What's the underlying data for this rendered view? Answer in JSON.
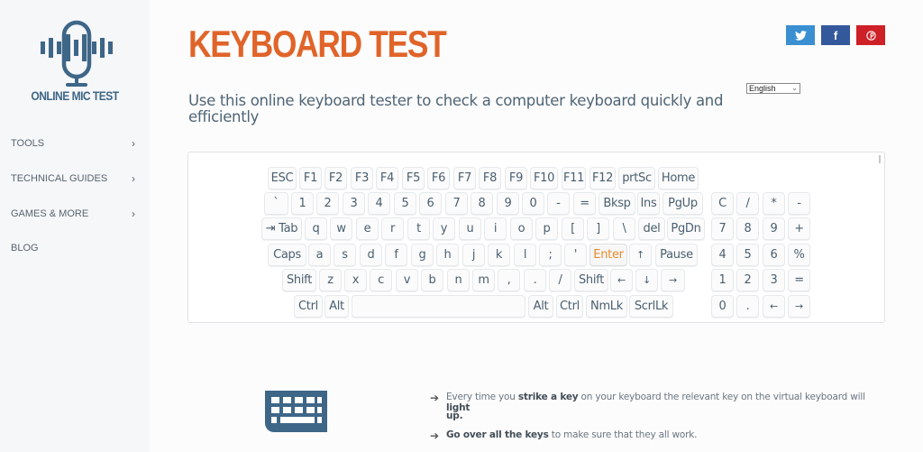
{
  "sidebar": {
    "logo_text": "ONLINE MIC TEST",
    "items": [
      {
        "label": "TOOLS",
        "chevron": "›"
      },
      {
        "label": "TECHNICAL GUIDES",
        "chevron": "›"
      },
      {
        "label": "GAMES & MORE",
        "chevron": "›"
      },
      {
        "label": "BLOG",
        "chevron": ""
      }
    ]
  },
  "header": {
    "title": "KEYBOARD TEST",
    "subtitle": "Use this online keyboard tester to check a computer keyboard quickly and efficiently",
    "social": [
      {
        "name": "twitter",
        "icon": "twitter-icon",
        "color": "#3a8fd1"
      },
      {
        "name": "facebook",
        "icon": "facebook-icon",
        "color": "#34589c"
      },
      {
        "name": "pinterest",
        "icon": "pinterest-icon",
        "color": "#cd2027"
      }
    ],
    "language": {
      "selected": "English"
    }
  },
  "keyboard": {
    "active_key": "Enter",
    "rows": [
      [
        "ESC",
        "F1",
        "F2",
        "F3",
        "F4",
        "F5",
        "F6",
        "F7",
        "F8",
        "F9",
        "F10",
        "F11",
        "F12",
        "prtSc",
        "Home"
      ],
      [
        "`",
        "1",
        "2",
        "3",
        "4",
        "5",
        "6",
        "7",
        "8",
        "9",
        "0",
        "-",
        "=",
        "Bksp",
        "Ins",
        "PgUp"
      ],
      [
        "⇥ Tab",
        "q",
        "w",
        "e",
        "r",
        "t",
        "y",
        "u",
        "i",
        "o",
        "p",
        "[",
        "]",
        "\\",
        "del",
        "PgDn"
      ],
      [
        "Caps",
        "a",
        "s",
        "d",
        "f",
        "g",
        "h",
        "j",
        "k",
        "l",
        ";",
        "'",
        "Enter",
        "↑",
        "Pause"
      ],
      [
        "Shift",
        "z",
        "x",
        "c",
        "v",
        "b",
        "n",
        "m",
        ",",
        ".",
        "/",
        "Shift",
        "←",
        "↓",
        "→"
      ],
      [
        "Ctrl",
        "Alt",
        "",
        "Alt",
        "Ctrl",
        "NmLk",
        "ScrlLk"
      ]
    ],
    "numpad": [
      [
        "C",
        "/",
        "*",
        "-"
      ],
      [
        "7",
        "8",
        "9",
        "+"
      ],
      [
        "4",
        "5",
        "6",
        "%"
      ],
      [
        "1",
        "2",
        "3",
        "="
      ],
      [
        "0",
        ".",
        "←",
        "→"
      ]
    ]
  },
  "tips": [
    {
      "parts": [
        {
          "t": "Every time you ",
          "b": false
        },
        {
          "t": "strike a key",
          "b": true
        },
        {
          "t": " on your keyboard the relevant key on the virtual keyboard will ",
          "b": false
        },
        {
          "t": "light",
          "b": true
        }
      ],
      "cont": "up."
    },
    {
      "parts": [
        {
          "t": "Go over all the keys",
          "b": true
        },
        {
          "t": " to make sure that they all work.",
          "b": false
        }
      ]
    }
  ],
  "colors": {
    "accent": "#e0642a",
    "brand": "#3e6687",
    "active_key": "#e88a2b"
  }
}
